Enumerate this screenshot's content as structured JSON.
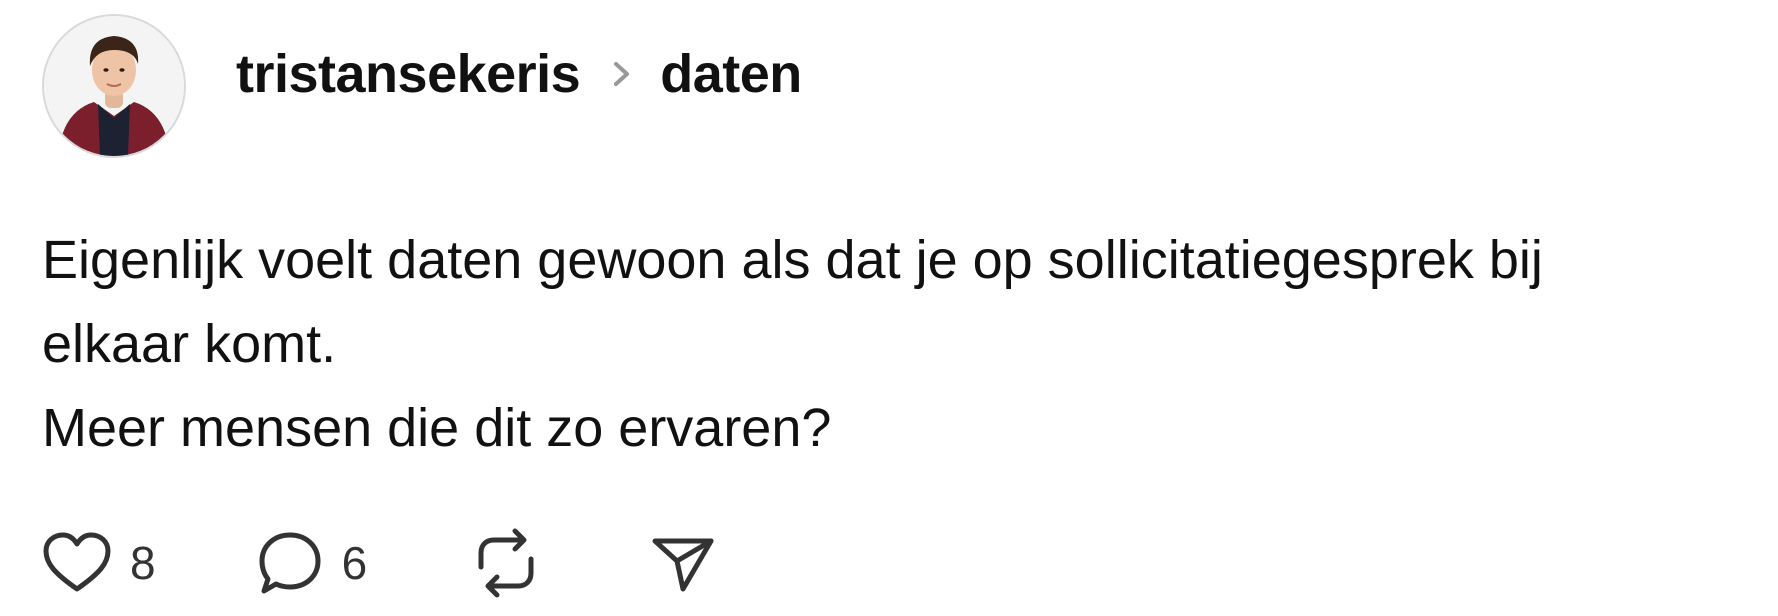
{
  "post": {
    "author": "tristansekeris",
    "topic": "daten",
    "avatar_alt": "tristansekeris",
    "body_lines": [
      "Eigenlijk voelt daten gewoon als dat je op sollicitatiegesprek bij",
      "elkaar komt.",
      "Meer mensen die dit zo ervaren?"
    ],
    "actions": {
      "like_count": "8",
      "reply_count": "6"
    }
  },
  "icons": {
    "like": "heart-icon",
    "reply": "speech-bubble-icon",
    "repost": "repost-icon",
    "share": "send-icon",
    "separator": "chevron-right-icon"
  },
  "colors": {
    "text": "#111111",
    "muted": "#333333",
    "chevron": "#999999",
    "avatar_jacket": "#7a1f2b"
  }
}
